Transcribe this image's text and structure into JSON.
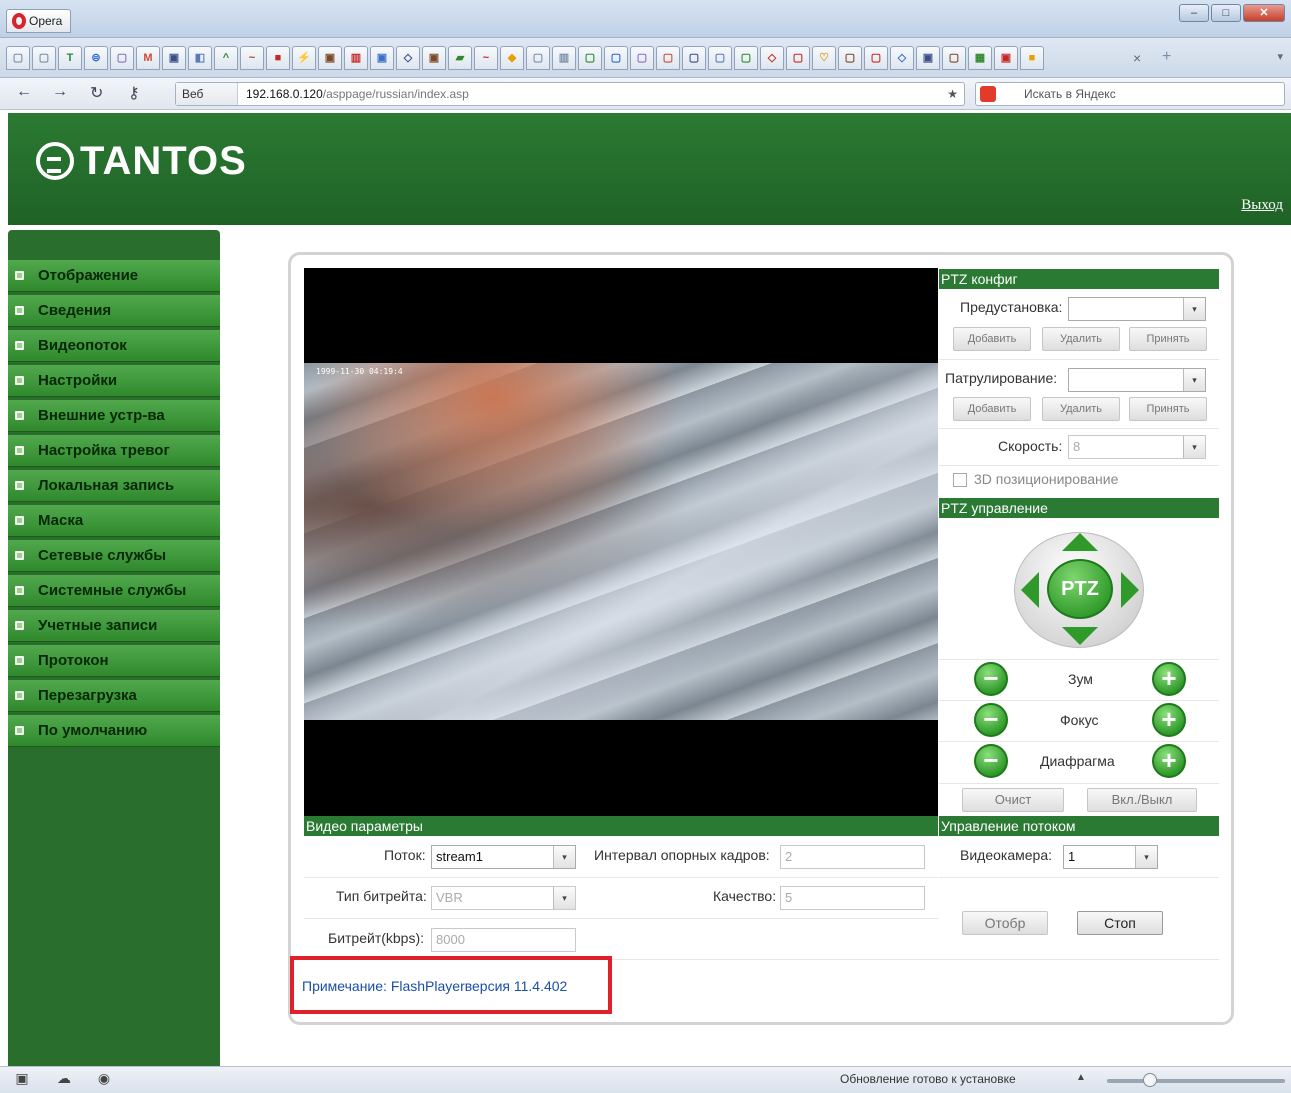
{
  "browser": {
    "app_button": "Opera",
    "window_controls": {
      "minimize": "–",
      "maximize": "□",
      "close": "✕"
    },
    "tab_glyphs": [
      "▢",
      "▢",
      "T",
      "⊜",
      "▢",
      "M",
      "▣",
      "◧",
      "^",
      "~",
      "■",
      "⚡",
      "▣",
      "▥",
      "▣",
      "◇",
      "▣",
      "▰",
      "~",
      "◆",
      "▢",
      "▥",
      "▢",
      "▢",
      "▢",
      "▢",
      "▢",
      "▢",
      "▢",
      "◇",
      "▢",
      "♡",
      "▢",
      "▢",
      "◇",
      "▣",
      "▢",
      "▦",
      "▣",
      "■"
    ],
    "tab_close": "×",
    "tab_add": "+",
    "tab_menu": "▾",
    "nav": {
      "back": "←",
      "forward": "→",
      "reload": "↻",
      "key": "⚷"
    },
    "address": {
      "badge": "Веб",
      "host": "192.168.0.120",
      "path": "/asppage/russian/index.asp"
    },
    "search_placeholder": "Искать в Яндекс",
    "bookmark_star": "★"
  },
  "page": {
    "logo_text": "TANTOS",
    "logout": "Выход",
    "sidebar_items": [
      "Отображение",
      "Сведения",
      "Видеопоток",
      "Настройки",
      "Внешние устр-ва",
      "Настройка тревог",
      "Локальная запись",
      "Маска",
      "Сетевые службы",
      "Системные службы",
      "Учетные записи",
      "Протокон",
      "Перезагрузка",
      "По умолчанию"
    ],
    "video_timestamp": "1999-11-30 04:19:4",
    "ptz_config": {
      "title": "PTZ конфиг",
      "preset_label": "Предустановка:",
      "preset_value": "",
      "patrol_label": "Патрулирование:",
      "patrol_value": "",
      "add": "Добавить",
      "delete": "Удалить",
      "apply": "Принять",
      "speed_label": "Скорость:",
      "speed_value": "8",
      "pos3d_label": "3D позиционирование"
    },
    "ptz_control": {
      "title": "PTZ управление",
      "center": "PTZ",
      "minus": "−",
      "plus": "+",
      "zoom": "Зум",
      "focus": "Фокус",
      "iris": "Диафрагма",
      "clear": "Очист",
      "onoff": "Вкл./Выкл"
    },
    "video_params": {
      "title": "Видео параметры",
      "stream_label": "Поток:",
      "stream_value": "stream1",
      "keyframe_label": "Интервал опорных кадров:",
      "keyframe_value": "2",
      "bitrate_type_label": "Тип битрейта:",
      "bitrate_type_value": "VBR",
      "quality_label": "Качество:",
      "quality_value": "5",
      "bitrate_label": "Битрейт(kbps):",
      "bitrate_value": "8000"
    },
    "stream_control": {
      "title": "Управление потоком",
      "camera_label": "Видеокамера:",
      "camera_value": "1",
      "show": "Отобр",
      "stop": "Стоп"
    },
    "note": "Примечание: FlashPlayerверсия 11.4.402"
  },
  "statusbar": {
    "icons": [
      "▣",
      "☁",
      "◉"
    ],
    "update_text": "Обновление готово к установке",
    "caret": "▲",
    "zoom_level": 0.24
  }
}
